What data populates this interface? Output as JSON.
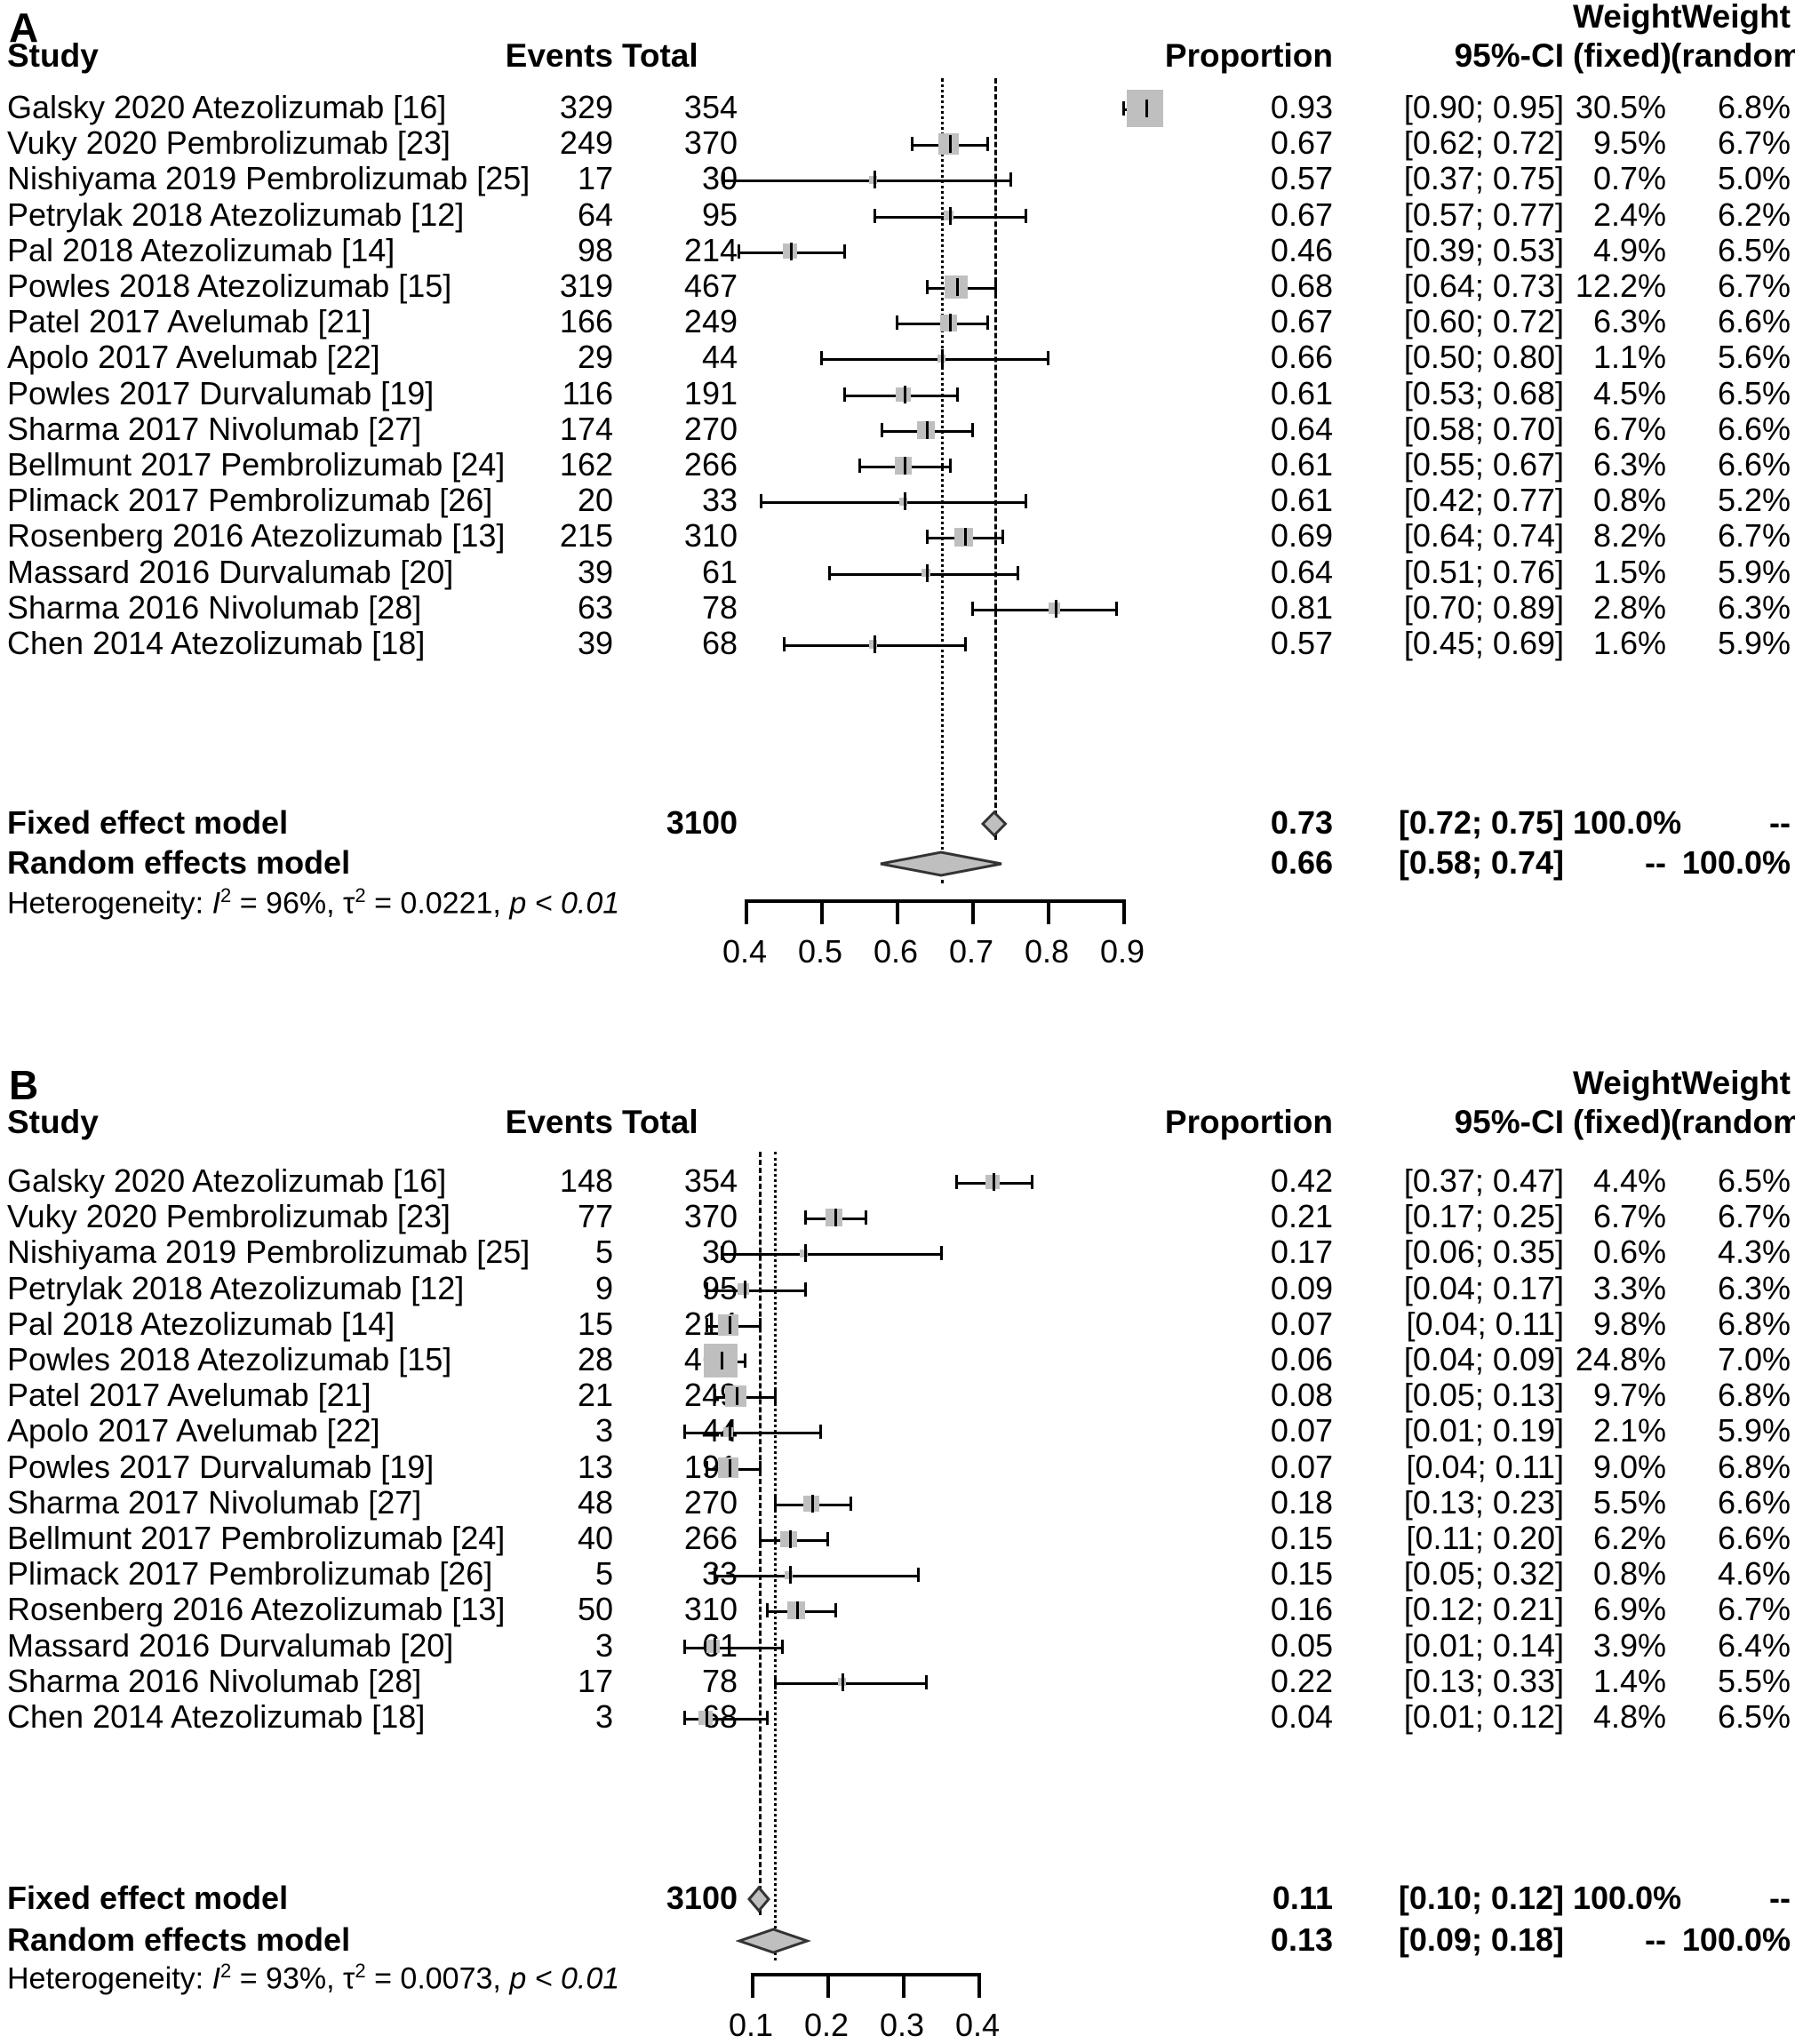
{
  "figure": {
    "panel_a_letter": "A",
    "panel_b_letter": "B"
  },
  "columns": {
    "study": "Study",
    "events": "Events",
    "total": "Total",
    "proportion": "Proportion",
    "ci": "95%-CI",
    "weight": "Weight",
    "weight_fixed": "(fixed)",
    "weight_random": "(random)"
  },
  "labels": {
    "fixed_effect_model": "Fixed effect model",
    "random_effects_model": "Random effects model",
    "heterogeneity_prefix": "Heterogeneity:",
    "dash": "--"
  },
  "chart_data": [
    {
      "type": "forest",
      "panel": "A",
      "title": "",
      "xlabel": "",
      "xlim": [
        0.35,
        0.95
      ],
      "xticks": [
        0.4,
        0.5,
        0.6,
        0.7,
        0.8,
        0.9
      ],
      "xtick_labels": [
        "0.4",
        "0.5",
        "0.6",
        "0.7",
        "0.8",
        "0.9"
      ],
      "total_n": "3100",
      "fixed_ref_line": 0.73,
      "random_ref_line": 0.66,
      "rows": [
        {
          "study": "Galsky 2020 Atezolizumab [16]",
          "events": "329",
          "total": "354",
          "proportion": "0.93",
          "prop": 0.93,
          "ci": "[0.90; 0.95]",
          "lo": 0.9,
          "hi": 0.95,
          "weight_fixed": "30.5%",
          "weight_random": "6.8%",
          "wf": 30.5
        },
        {
          "study": "Vuky 2020 Pembrolizumab [23]",
          "events": "249",
          "total": "370",
          "proportion": "0.67",
          "prop": 0.67,
          "ci": "[0.62; 0.72]",
          "lo": 0.62,
          "hi": 0.72,
          "weight_fixed": "9.5%",
          "weight_random": "6.7%",
          "wf": 9.5
        },
        {
          "study": "Nishiyama 2019 Pembrolizumab [25]",
          "events": "17",
          "total": "30",
          "proportion": "0.57",
          "prop": 0.57,
          "ci": "[0.37; 0.75]",
          "lo": 0.37,
          "hi": 0.75,
          "weight_fixed": "0.7%",
          "weight_random": "5.0%",
          "wf": 0.7
        },
        {
          "study": "Petrylak 2018 Atezolizumab [12]",
          "events": "64",
          "total": "95",
          "proportion": "0.67",
          "prop": 0.67,
          "ci": "[0.57; 0.77]",
          "lo": 0.57,
          "hi": 0.77,
          "weight_fixed": "2.4%",
          "weight_random": "6.2%",
          "wf": 2.4
        },
        {
          "study": "Pal 2018 Atezolizumab [14]",
          "events": "98",
          "total": "214",
          "proportion": "0.46",
          "prop": 0.46,
          "ci": "[0.39; 0.53]",
          "lo": 0.39,
          "hi": 0.53,
          "weight_fixed": "4.9%",
          "weight_random": "6.5%",
          "wf": 4.9
        },
        {
          "study": "Powles 2018 Atezolizumab [15]",
          "events": "319",
          "total": "467",
          "proportion": "0.68",
          "prop": 0.68,
          "ci": "[0.64; 0.73]",
          "lo": 0.64,
          "hi": 0.73,
          "weight_fixed": "12.2%",
          "weight_random": "6.7%",
          "wf": 12.2
        },
        {
          "study": "Patel 2017 Avelumab [21]",
          "events": "166",
          "total": "249",
          "proportion": "0.67",
          "prop": 0.67,
          "ci": "[0.60; 0.72]",
          "lo": 0.6,
          "hi": 0.72,
          "weight_fixed": "6.3%",
          "weight_random": "6.6%",
          "wf": 6.3
        },
        {
          "study": "Apolo 2017 Avelumab [22]",
          "events": "29",
          "total": "44",
          "proportion": "0.66",
          "prop": 0.66,
          "ci": "[0.50; 0.80]",
          "lo": 0.5,
          "hi": 0.8,
          "weight_fixed": "1.1%",
          "weight_random": "5.6%",
          "wf": 1.1
        },
        {
          "study": "Powles 2017 Durvalumab [19]",
          "events": "116",
          "total": "191",
          "proportion": "0.61",
          "prop": 0.61,
          "ci": "[0.53; 0.68]",
          "lo": 0.53,
          "hi": 0.68,
          "weight_fixed": "4.5%",
          "weight_random": "6.5%",
          "wf": 4.5
        },
        {
          "study": "Sharma 2017 Nivolumab [27]",
          "events": "174",
          "total": "270",
          "proportion": "0.64",
          "prop": 0.64,
          "ci": "[0.58; 0.70]",
          "lo": 0.58,
          "hi": 0.7,
          "weight_fixed": "6.7%",
          "weight_random": "6.6%",
          "wf": 6.7
        },
        {
          "study": "Bellmunt 2017 Pembrolizumab [24]",
          "events": "162",
          "total": "266",
          "proportion": "0.61",
          "prop": 0.61,
          "ci": "[0.55; 0.67]",
          "lo": 0.55,
          "hi": 0.67,
          "weight_fixed": "6.3%",
          "weight_random": "6.6%",
          "wf": 6.3
        },
        {
          "study": "Plimack 2017 Pembrolizumab [26]",
          "events": "20",
          "total": "33",
          "proportion": "0.61",
          "prop": 0.61,
          "ci": "[0.42; 0.77]",
          "lo": 0.42,
          "hi": 0.77,
          "weight_fixed": "0.8%",
          "weight_random": "5.2%",
          "wf": 0.8
        },
        {
          "study": "Rosenberg 2016 Atezolizumab [13]",
          "events": "215",
          "total": "310",
          "proportion": "0.69",
          "prop": 0.69,
          "ci": "[0.64; 0.74]",
          "lo": 0.64,
          "hi": 0.74,
          "weight_fixed": "8.2%",
          "weight_random": "6.7%",
          "wf": 8.2
        },
        {
          "study": "Massard 2016 Durvalumab [20]",
          "events": "39",
          "total": "61",
          "proportion": "0.64",
          "prop": 0.64,
          "ci": "[0.51; 0.76]",
          "lo": 0.51,
          "hi": 0.76,
          "weight_fixed": "1.5%",
          "weight_random": "5.9%",
          "wf": 1.5
        },
        {
          "study": "Sharma 2016 Nivolumab [28]",
          "events": "63",
          "total": "78",
          "proportion": "0.81",
          "prop": 0.81,
          "ci": "[0.70; 0.89]",
          "lo": 0.7,
          "hi": 0.89,
          "weight_fixed": "2.8%",
          "weight_random": "6.3%",
          "wf": 2.8
        },
        {
          "study": "Chen 2014 Atezolizumab [18]",
          "events": "39",
          "total": "68",
          "proportion": "0.57",
          "prop": 0.57,
          "ci": "[0.45; 0.69]",
          "lo": 0.45,
          "hi": 0.69,
          "weight_fixed": "1.6%",
          "weight_random": "5.9%",
          "wf": 1.6
        }
      ],
      "fixed": {
        "proportion": "0.73",
        "prop": 0.73,
        "ci": "[0.72; 0.75]",
        "lo": 0.72,
        "hi": 0.75,
        "weight_fixed": "100.0%",
        "weight_random": "--"
      },
      "random": {
        "proportion": "0.66",
        "prop": 0.66,
        "ci": "[0.58; 0.74]",
        "lo": 0.58,
        "hi": 0.74,
        "weight_fixed": "--",
        "weight_random": "100.0%"
      },
      "heterogeneity": {
        "i2": "96%",
        "tau2": "0.0221",
        "p": "p < 0.01"
      }
    },
    {
      "type": "forest",
      "panel": "B",
      "title": "",
      "xlabel": "",
      "xlim": [
        0.02,
        0.45
      ],
      "xticks": [
        0.1,
        0.2,
        0.3,
        0.4
      ],
      "xtick_labels": [
        "0.1",
        "0.2",
        "0.3",
        "0.4"
      ],
      "total_n": "3100",
      "fixed_ref_line": 0.11,
      "random_ref_line": 0.13,
      "rows": [
        {
          "study": "Galsky 2020 Atezolizumab [16]",
          "events": "148",
          "total": "354",
          "proportion": "0.42",
          "prop": 0.42,
          "ci": "[0.37; 0.47]",
          "lo": 0.37,
          "hi": 0.47,
          "weight_fixed": "4.4%",
          "weight_random": "6.5%",
          "wf": 4.4
        },
        {
          "study": "Vuky 2020 Pembrolizumab [23]",
          "events": "77",
          "total": "370",
          "proportion": "0.21",
          "prop": 0.21,
          "ci": "[0.17; 0.25]",
          "lo": 0.17,
          "hi": 0.25,
          "weight_fixed": "6.7%",
          "weight_random": "6.7%",
          "wf": 6.7
        },
        {
          "study": "Nishiyama 2019 Pembrolizumab [25]",
          "events": "5",
          "total": "30",
          "proportion": "0.17",
          "prop": 0.17,
          "ci": "[0.06; 0.35]",
          "lo": 0.06,
          "hi": 0.35,
          "weight_fixed": "0.6%",
          "weight_random": "4.3%",
          "wf": 0.6
        },
        {
          "study": "Petrylak 2018 Atezolizumab [12]",
          "events": "9",
          "total": "95",
          "proportion": "0.09",
          "prop": 0.09,
          "ci": "[0.04; 0.17]",
          "lo": 0.04,
          "hi": 0.17,
          "weight_fixed": "3.3%",
          "weight_random": "6.3%",
          "wf": 3.3
        },
        {
          "study": "Pal 2018 Atezolizumab [14]",
          "events": "15",
          "total": "214",
          "proportion": "0.07",
          "prop": 0.07,
          "ci": "[0.04; 0.11]",
          "lo": 0.04,
          "hi": 0.11,
          "weight_fixed": "9.8%",
          "weight_random": "6.8%",
          "wf": 9.8
        },
        {
          "study": "Powles 2018 Atezolizumab [15]",
          "events": "28",
          "total": "467",
          "proportion": "0.06",
          "prop": 0.06,
          "ci": "[0.04; 0.09]",
          "lo": 0.04,
          "hi": 0.09,
          "weight_fixed": "24.8%",
          "weight_random": "7.0%",
          "wf": 24.8
        },
        {
          "study": "Patel 2017 Avelumab [21]",
          "events": "21",
          "total": "249",
          "proportion": "0.08",
          "prop": 0.08,
          "ci": "[0.05; 0.13]",
          "lo": 0.05,
          "hi": 0.13,
          "weight_fixed": "9.7%",
          "weight_random": "6.8%",
          "wf": 9.7
        },
        {
          "study": "Apolo 2017 Avelumab [22]",
          "events": "3",
          "total": "44",
          "proportion": "0.07",
          "prop": 0.07,
          "ci": "[0.01; 0.19]",
          "lo": 0.01,
          "hi": 0.19,
          "weight_fixed": "2.1%",
          "weight_random": "5.9%",
          "wf": 2.1
        },
        {
          "study": "Powles 2017 Durvalumab [19]",
          "events": "13",
          "total": "191",
          "proportion": "0.07",
          "prop": 0.07,
          "ci": "[0.04; 0.11]",
          "lo": 0.04,
          "hi": 0.11,
          "weight_fixed": "9.0%",
          "weight_random": "6.8%",
          "wf": 9.0
        },
        {
          "study": "Sharma 2017 Nivolumab [27]",
          "events": "48",
          "total": "270",
          "proportion": "0.18",
          "prop": 0.18,
          "ci": "[0.13; 0.23]",
          "lo": 0.13,
          "hi": 0.23,
          "weight_fixed": "5.5%",
          "weight_random": "6.6%",
          "wf": 5.5
        },
        {
          "study": "Bellmunt 2017 Pembrolizumab [24]",
          "events": "40",
          "total": "266",
          "proportion": "0.15",
          "prop": 0.15,
          "ci": "[0.11; 0.20]",
          "lo": 0.11,
          "hi": 0.2,
          "weight_fixed": "6.2%",
          "weight_random": "6.6%",
          "wf": 6.2
        },
        {
          "study": "Plimack 2017 Pembrolizumab [26]",
          "events": "5",
          "total": "33",
          "proportion": "0.15",
          "prop": 0.15,
          "ci": "[0.05; 0.32]",
          "lo": 0.05,
          "hi": 0.32,
          "weight_fixed": "0.8%",
          "weight_random": "4.6%",
          "wf": 0.8
        },
        {
          "study": "Rosenberg 2016 Atezolizumab [13]",
          "events": "50",
          "total": "310",
          "proportion": "0.16",
          "prop": 0.16,
          "ci": "[0.12; 0.21]",
          "lo": 0.12,
          "hi": 0.21,
          "weight_fixed": "6.9%",
          "weight_random": "6.7%",
          "wf": 6.9
        },
        {
          "study": "Massard 2016 Durvalumab [20]",
          "events": "3",
          "total": "61",
          "proportion": "0.05",
          "prop": 0.05,
          "ci": "[0.01; 0.14]",
          "lo": 0.01,
          "hi": 0.14,
          "weight_fixed": "3.9%",
          "weight_random": "6.4%",
          "wf": 3.9
        },
        {
          "study": "Sharma 2016 Nivolumab [28]",
          "events": "17",
          "total": "78",
          "proportion": "0.22",
          "prop": 0.22,
          "ci": "[0.13; 0.33]",
          "lo": 0.13,
          "hi": 0.33,
          "weight_fixed": "1.4%",
          "weight_random": "5.5%",
          "wf": 1.4
        },
        {
          "study": "Chen 2014 Atezolizumab [18]",
          "events": "3",
          "total": "68",
          "proportion": "0.04",
          "prop": 0.04,
          "ci": "[0.01; 0.12]",
          "lo": 0.01,
          "hi": 0.12,
          "weight_fixed": "4.8%",
          "weight_random": "6.5%",
          "wf": 4.8
        }
      ],
      "fixed": {
        "proportion": "0.11",
        "prop": 0.11,
        "ci": "[0.10; 0.12]",
        "lo": 0.1,
        "hi": 0.12,
        "weight_fixed": "100.0%",
        "weight_random": "--"
      },
      "random": {
        "proportion": "0.13",
        "prop": 0.13,
        "ci": "[0.09; 0.18]",
        "lo": 0.09,
        "hi": 0.18,
        "weight_fixed": "--",
        "weight_random": "100.0%"
      },
      "heterogeneity": {
        "i2": "93%",
        "tau2": "0.0073",
        "p": "p < 0.01"
      }
    }
  ],
  "colors": {
    "marker_fill": "#bfbfbf",
    "line": "#000000",
    "text": "#000000"
  }
}
